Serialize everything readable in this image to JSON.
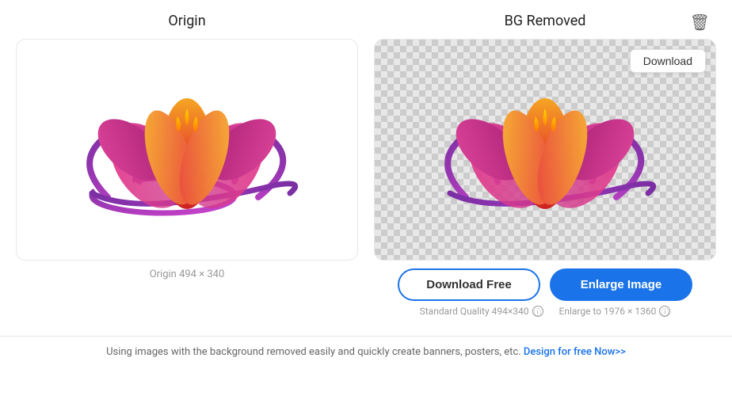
{
  "origin_panel": {
    "title": "Origin",
    "label": "Origin 494 × 340"
  },
  "bg_removed_panel": {
    "title": "BG Removed"
  },
  "download_btn": "Download",
  "download_free_btn": "Download Free",
  "enlarge_btn": "Enlarge Image",
  "quality_standard": "Standard Quality 494×340",
  "quality_enlarge": "Enlarge to 1976 × 1360",
  "footer_text": "Using images with the background removed easily and quickly create banners, posters, etc.",
  "footer_link": "Design for free Now>>",
  "info_icon": "ℹ",
  "delete_icon": "🗑",
  "colors": {
    "accent": "#1a73e8"
  }
}
